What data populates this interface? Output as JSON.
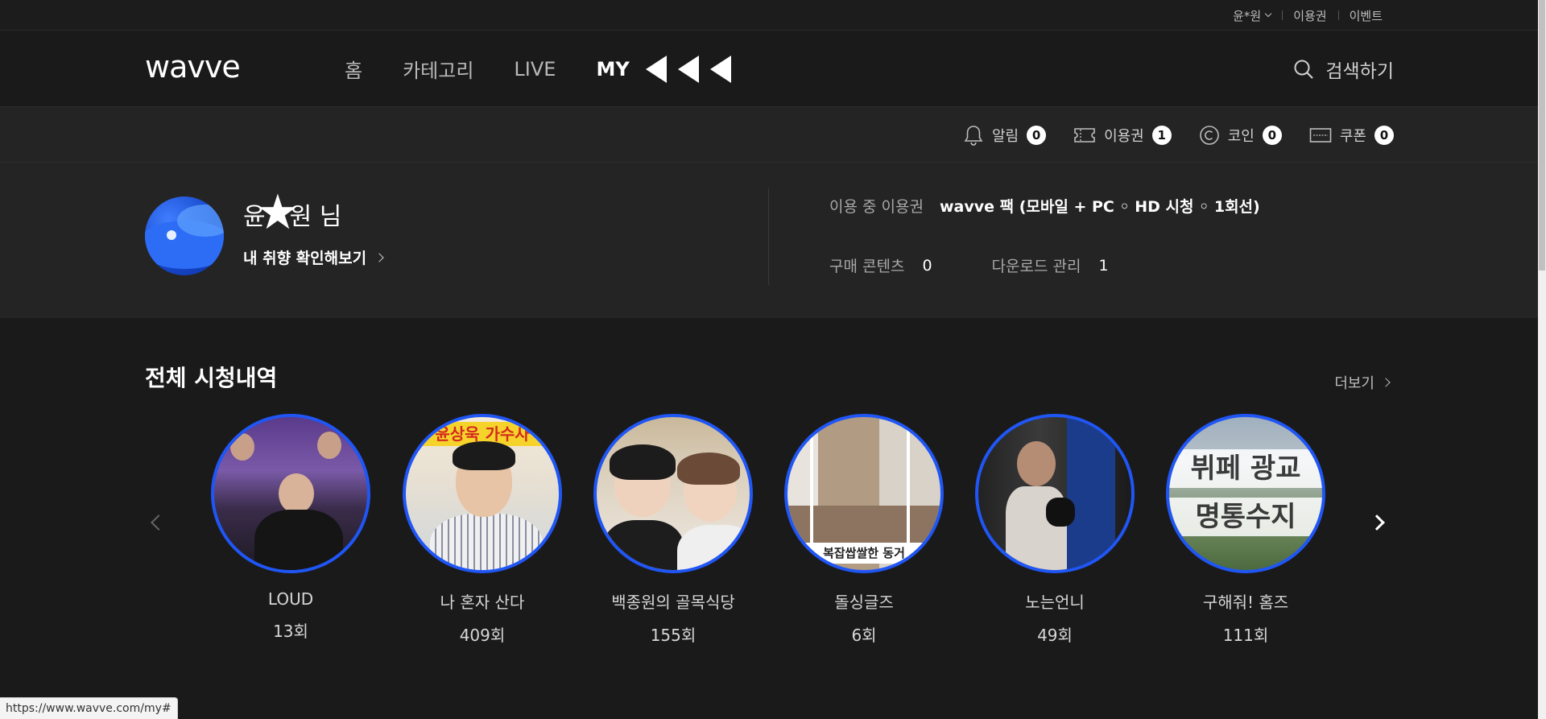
{
  "topbar": {
    "user_label": "윤*원",
    "pass_label": "이용권",
    "event_label": "이벤트"
  },
  "header": {
    "logo": "wavve",
    "nav": [
      {
        "label": "홈"
      },
      {
        "label": "카테고리"
      },
      {
        "label": "LIVE"
      },
      {
        "label": "MY"
      }
    ],
    "search_label": "검색하기"
  },
  "status": {
    "items": [
      {
        "label": "알림",
        "count": "0",
        "icon": "bell-icon"
      },
      {
        "label": "이용권",
        "count": "1",
        "icon": "ticket-icon"
      },
      {
        "label": "코인",
        "count": "0",
        "icon": "coin-icon"
      },
      {
        "label": "쿠폰",
        "count": "0",
        "icon": "coupon-icon"
      }
    ]
  },
  "profile": {
    "name_prefix": "윤",
    "name_suffix": "원 님",
    "taste_link": "내 취향 확인해보기",
    "plan_label": "이용 중 이용권",
    "plan_value": "wavve 팩 (모바일 + PC ◦ HD 시청 ◦ 1회선)",
    "purchase_label": "구매 콘텐츠",
    "purchase_value": "0",
    "download_label": "다운로드 관리",
    "download_value": "1"
  },
  "history": {
    "title": "전체 시청내역",
    "more_label": "더보기",
    "items": [
      {
        "title": "LOUD",
        "episode": "13회"
      },
      {
        "title": "나 혼자 산다",
        "episode": "409회"
      },
      {
        "title": "백종원의 골목식당",
        "episode": "155회"
      },
      {
        "title": "돌싱글즈",
        "episode": "6회"
      },
      {
        "title": "노는언니",
        "episode": "49회"
      },
      {
        "title": "구해줘! 홈즈",
        "episode": "111회"
      }
    ]
  },
  "thumb_text": {
    "t2_banner": "윤상욱 가수사",
    "t4_caption": "복잡쌉쌀한 동거",
    "t6_line1": "뷔페 광교",
    "t6_line2": "명통수지"
  },
  "status_url": "https://www.wavve.com/my#",
  "colors": {
    "accent_ring": "#1f56f5",
    "background": "#1a1a1a",
    "panel": "#242424"
  }
}
